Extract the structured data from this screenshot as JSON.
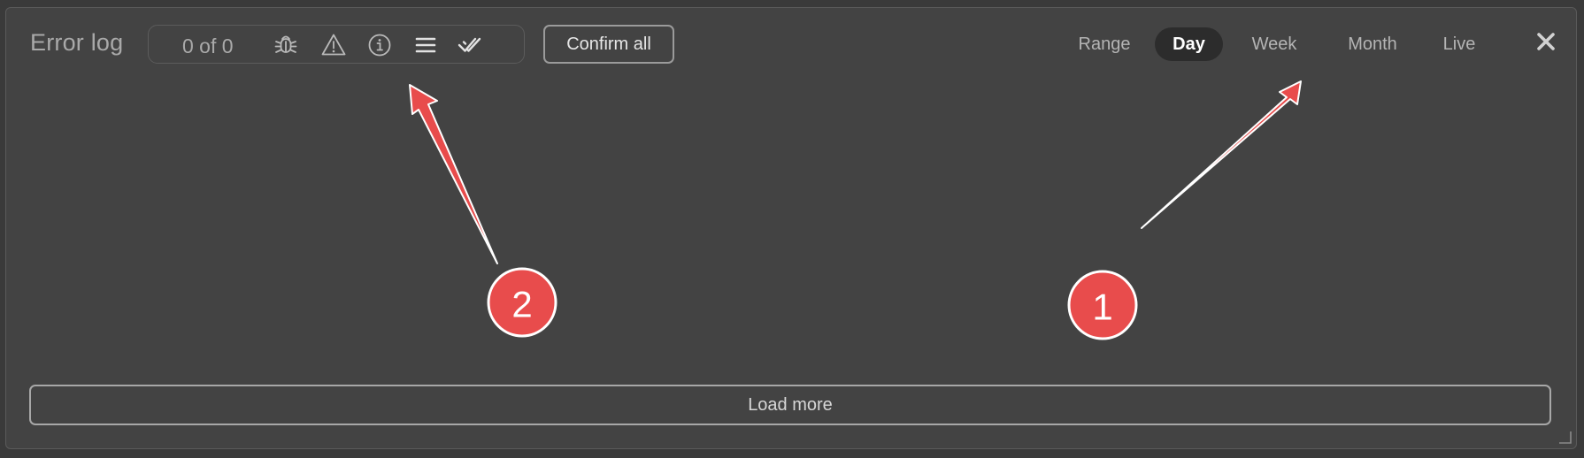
{
  "panel": {
    "title": "Error log",
    "filter": {
      "count_label": "0 of 0",
      "icons": [
        "bug-icon",
        "warning-icon",
        "info-icon",
        "list-icon",
        "double-check-icon"
      ]
    },
    "confirm_all_label": "Confirm all",
    "time_tabs": [
      {
        "label": "Range",
        "active": false
      },
      {
        "label": "Day",
        "active": true
      },
      {
        "label": "Week",
        "active": false
      },
      {
        "label": "Month",
        "active": false
      },
      {
        "label": "Live",
        "active": false
      }
    ],
    "close_icon": "close-icon",
    "load_more_label": "Load more"
  },
  "annotations": [
    {
      "number": "1"
    },
    {
      "number": "2"
    }
  ],
  "colors": {
    "background": "#434343",
    "active_tab": "#2c2c2c",
    "annotation": "#e84c4c"
  }
}
